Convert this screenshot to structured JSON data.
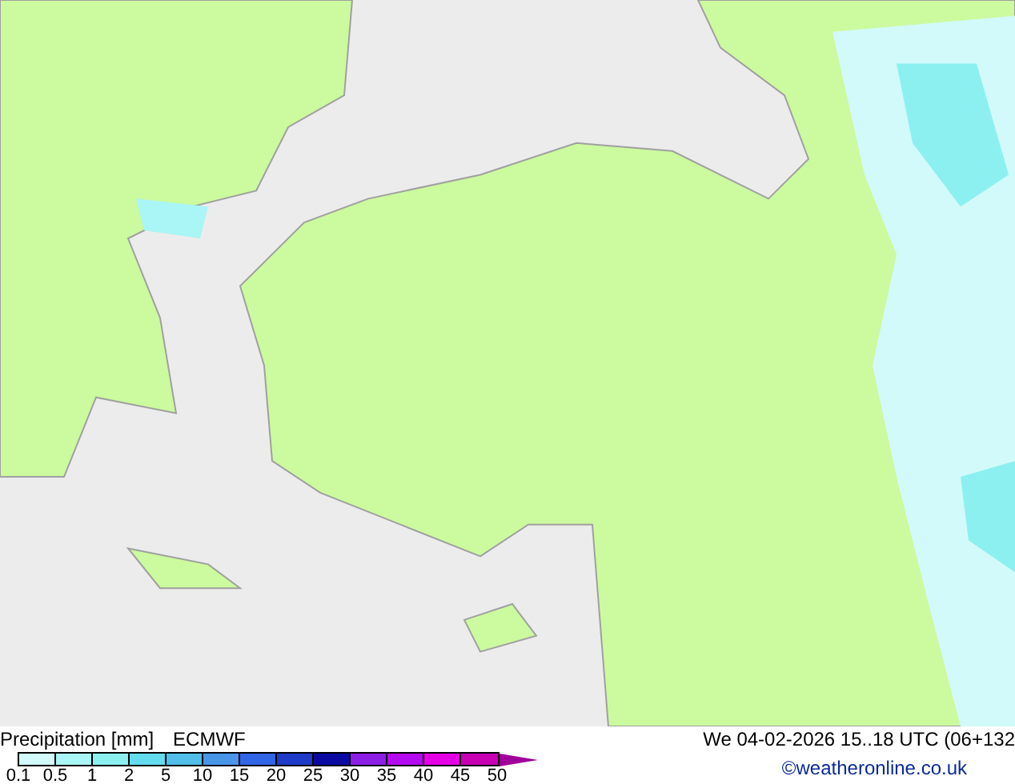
{
  "legend": {
    "title": "Precipitation [mm]",
    "model": "ECMWF",
    "swatches": [
      {
        "color": "#d2fafa"
      },
      {
        "color": "#aaf5f5"
      },
      {
        "color": "#8cf0f0"
      },
      {
        "color": "#64dcf0"
      },
      {
        "color": "#50bee8"
      },
      {
        "color": "#4896e8"
      },
      {
        "color": "#3264e6"
      },
      {
        "color": "#1e3cc8"
      },
      {
        "color": "#0a0aa0"
      },
      {
        "color": "#8c1ee6"
      },
      {
        "color": "#b40af0"
      },
      {
        "color": "#e600e6"
      },
      {
        "color": "#c800b4"
      }
    ],
    "labels": [
      "0.1",
      "0.5",
      "1",
      "2",
      "5",
      "10",
      "15",
      "20",
      "25",
      "30",
      "35",
      "40",
      "45",
      "50"
    ]
  },
  "valid_time": "We 04-02-2026 15..18 UTC (06+132",
  "credit": "©weatheronline.co.uk"
}
